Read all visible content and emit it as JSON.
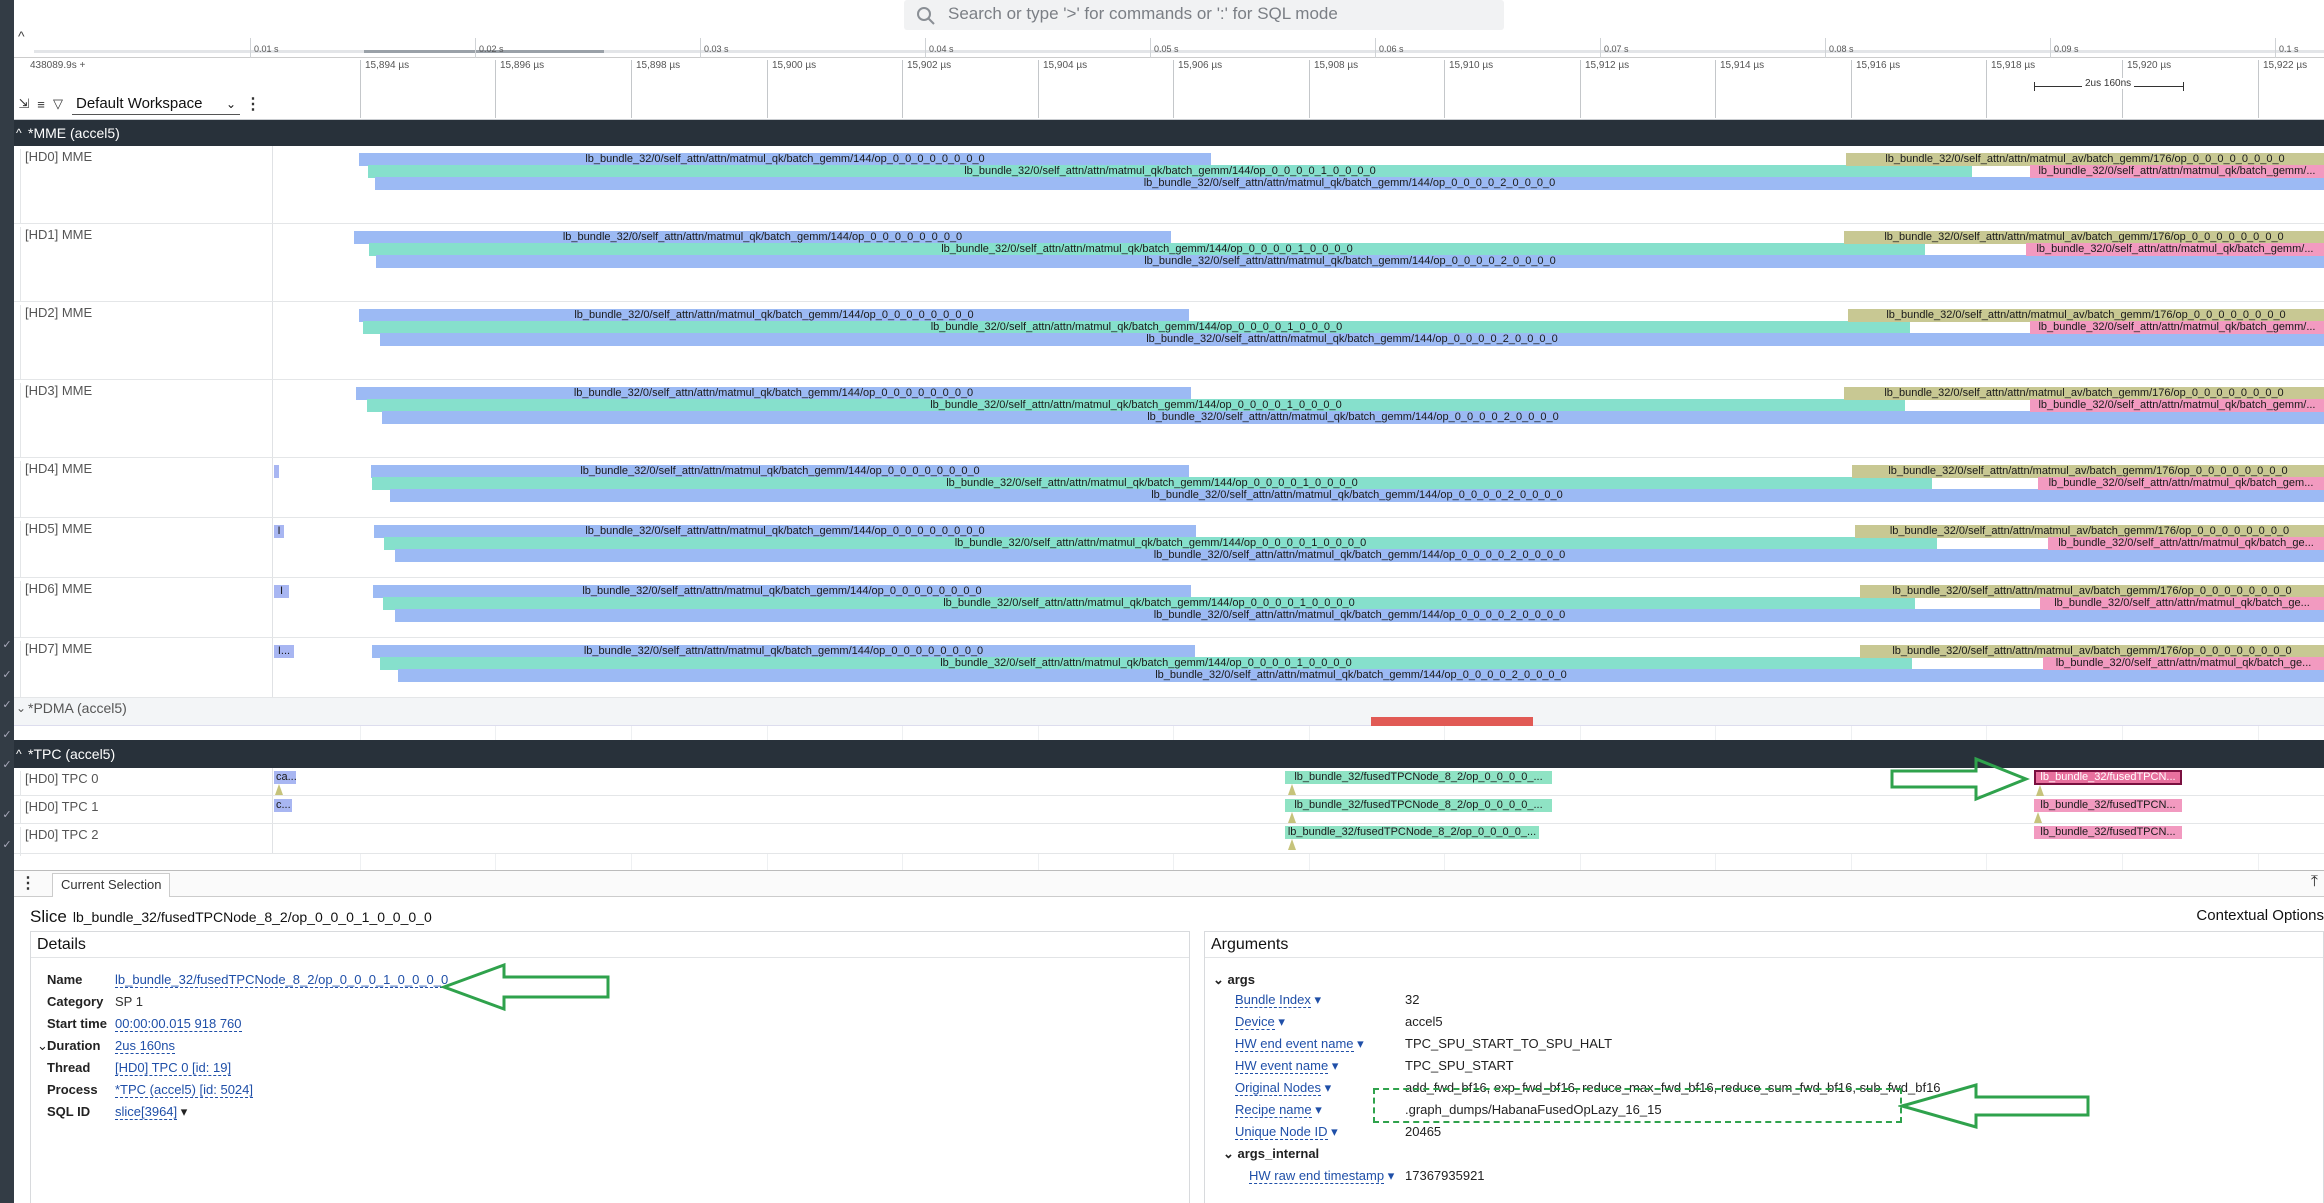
{
  "search": {
    "placeholder": "Search or type '>' for commands or ':' for SQL mode"
  },
  "overview": {
    "ticks": [
      "0.01 s",
      "0.02 s",
      "0.03 s",
      "0.04 s",
      "0.05 s",
      "0.06 s",
      "0.07 s",
      "0.08 s",
      "0.09 s",
      "0.1 s"
    ]
  },
  "ruler": {
    "offset": "438089.9s +",
    "ticks": [
      "15,894 µs",
      "15,896 µs",
      "15,898 µs",
      "15,900 µs",
      "15,902 µs",
      "15,904 µs",
      "15,906 µs",
      "15,908 µs",
      "15,910 µs",
      "15,912 µs",
      "15,914 µs",
      "15,916 µs",
      "15,918 µs",
      "15,920 µs",
      "15,922 µs"
    ],
    "scale": "2us 160ns"
  },
  "workspace": {
    "name": "Default Workspace"
  },
  "groups": {
    "mme": "*MME (accel5)",
    "pdma": "*PDMA (accel5)",
    "tpc": "*TPC (accel5)"
  },
  "mme_tracks": [
    {
      "label": "[HD0] MME",
      "s1": "lb_bundle_32/0/self_attn/attn/matmul_qk/batch_gemm/144/op_0_0_0_0_0_0_0_0",
      "s2": "lb_bundle_32/0/self_attn/attn/matmul_qk/batch_gemm/144/op_0_0_0_0_1_0_0_0_0",
      "s3": "lb_bundle_32/0/self_attn/attn/matmul_qk/batch_gemm/144/op_0_0_0_0_2_0_0_0_0",
      "av": "lb_bundle_32/0/self_attn/attn/matmul_av/batch_gemm/176/op_0_0_0_0_0_0_0_0",
      "pk": "lb_bundle_32/0/self_attn/attn/matmul_qk/batch_gemm/..."
    },
    {
      "label": "[HD1] MME",
      "s1": "lb_bundle_32/0/self_attn/attn/matmul_qk/batch_gemm/144/op_0_0_0_0_0_0_0_0",
      "s2": "lb_bundle_32/0/self_attn/attn/matmul_qk/batch_gemm/144/op_0_0_0_0_1_0_0_0_0",
      "s3": "lb_bundle_32/0/self_attn/attn/matmul_qk/batch_gemm/144/op_0_0_0_0_2_0_0_0_0",
      "av": "lb_bundle_32/0/self_attn/attn/matmul_av/batch_gemm/176/op_0_0_0_0_0_0_0_0",
      "pk": "lb_bundle_32/0/self_attn/attn/matmul_qk/batch_gemm/..."
    },
    {
      "label": "[HD2] MME",
      "s1": "lb_bundle_32/0/self_attn/attn/matmul_qk/batch_gemm/144/op_0_0_0_0_0_0_0_0",
      "s2": "lb_bundle_32/0/self_attn/attn/matmul_qk/batch_gemm/144/op_0_0_0_0_1_0_0_0_0",
      "s3": "lb_bundle_32/0/self_attn/attn/matmul_qk/batch_gemm/144/op_0_0_0_0_2_0_0_0_0",
      "av": "lb_bundle_32/0/self_attn/attn/matmul_av/batch_gemm/176/op_0_0_0_0_0_0_0_0",
      "pk": "lb_bundle_32/0/self_attn/attn/matmul_qk/batch_gemm/..."
    },
    {
      "label": "[HD3] MME",
      "s1": "lb_bundle_32/0/self_attn/attn/matmul_qk/batch_gemm/144/op_0_0_0_0_0_0_0_0",
      "s2": "lb_bundle_32/0/self_attn/attn/matmul_qk/batch_gemm/144/op_0_0_0_0_1_0_0_0_0",
      "s3": "lb_bundle_32/0/self_attn/attn/matmul_qk/batch_gemm/144/op_0_0_0_0_2_0_0_0_0",
      "av": "lb_bundle_32/0/self_attn/attn/matmul_av/batch_gemm/176/op_0_0_0_0_0_0_0_0",
      "pk": "lb_bundle_32/0/self_attn/attn/matmul_qk/batch_gemm/..."
    },
    {
      "label": "[HD4] MME",
      "s1": "lb_bundle_32/0/self_attn/attn/matmul_qk/batch_gemm/144/op_0_0_0_0_0_0_0_0",
      "s2": "lb_bundle_32/0/self_attn/attn/matmul_qk/batch_gemm/144/op_0_0_0_0_1_0_0_0_0",
      "s3": "lb_bundle_32/0/self_attn/attn/matmul_qk/batch_gemm/144/op_0_0_0_0_2_0_0_0_0",
      "av": "lb_bundle_32/0/self_attn/attn/matmul_av/batch_gemm/176/op_0_0_0_0_0_0_0_0",
      "pk": "lb_bundle_32/0/self_attn/attn/matmul_qk/batch_gem..."
    },
    {
      "label": "[HD5] MME",
      "s1": "lb_bundle_32/0/self_attn/attn/matmul_qk/batch_gemm/144/op_0_0_0_0_0_0_0_0",
      "s2": "lb_bundle_32/0/self_attn/attn/matmul_qk/batch_gemm/144/op_0_0_0_0_1_0_0_0_0",
      "s3": "lb_bundle_32/0/self_attn/attn/matmul_qk/batch_gemm/144/op_0_0_0_0_2_0_0_0_0",
      "av": "lb_bundle_32/0/self_attn/attn/matmul_av/batch_gemm/176/op_0_0_0_0_0_0_0_0",
      "pk": "lb_bundle_32/0/self_attn/attn/matmul_qk/batch_ge..."
    },
    {
      "label": "[HD6] MME",
      "s1": "lb_bundle_32/0/self_attn/attn/matmul_qk/batch_gemm/144/op_0_0_0_0_0_0_0_0",
      "s2": "lb_bundle_32/0/self_attn/attn/matmul_qk/batch_gemm/144/op_0_0_0_0_1_0_0_0_0",
      "s3": "lb_bundle_32/0/self_attn/attn/matmul_qk/batch_gemm/144/op_0_0_0_0_2_0_0_0_0",
      "av": "lb_bundle_32/0/self_attn/attn/matmul_av/batch_gemm/176/op_0_0_0_0_0_0_0_0",
      "pk": "lb_bundle_32/0/self_attn/attn/matmul_qk/batch_ge..."
    },
    {
      "label": "[HD7] MME",
      "s1": "lb_bundle_32/0/self_attn/attn/matmul_qk/batch_gemm/144/op_0_0_0_0_0_0_0_0",
      "s2": "lb_bundle_32/0/self_attn/attn/matmul_qk/batch_gemm/144/op_0_0_0_0_1_0_0_0_0",
      "s3": "lb_bundle_32/0/self_attn/attn/matmul_qk/batch_gemm/144/op_0_0_0_0_2_0_0_0_0",
      "av": "lb_bundle_32/0/self_attn/attn/matmul_av/batch_gemm/176/op_0_0_0_0_0_0_0_0",
      "pk": "lb_bundle_32/0/self_attn/attn/matmul_qk/batch_ge..."
    }
  ],
  "mme_small": [
    "",
    "I",
    "I",
    "I..."
  ],
  "tpc_tracks": [
    {
      "label": "[HD0] TPC 0",
      "small": "ca...",
      "mid": "lb_bundle_32/fusedTPCNode_8_2/op_0_0_0_0_...",
      "right": "lb_bundle_32/fusedTPCN..."
    },
    {
      "label": "[HD0] TPC 1",
      "small": "c...",
      "mid": "lb_bundle_32/fusedTPCNode_8_2/op_0_0_0_0_...",
      "right": "lb_bundle_32/fusedTPCN..."
    },
    {
      "label": "[HD0] TPC 2",
      "small": "",
      "mid": "lb_bundle_32/fusedTPCNode_8_2/op_0_0_0_0_...",
      "right": "lb_bundle_32/fusedTPCN..."
    }
  ],
  "bottom": {
    "tab": "Current Selection",
    "slice_kw": "Slice",
    "slice_name": "lb_bundle_32/fusedTPCNode_8_2/op_0_0_0_1_0_0_0_0",
    "contextual": "Contextual Options",
    "details_title": "Details",
    "details": [
      {
        "k": "Name",
        "v": "lb_bundle_32/fusedTPCNode_8_2/op_0_0_0_1_0_0_0_0"
      },
      {
        "k": "Category",
        "v": "SP 1"
      },
      {
        "k": "Start time",
        "v": "00:00:00.015 918 760"
      },
      {
        "k": "Duration",
        "v": "2us 160ns"
      },
      {
        "k": "Thread",
        "v": "[HD0] TPC 0 [id: 19]"
      },
      {
        "k": "Process",
        "v": "*TPC (accel5) [id: 5024]"
      },
      {
        "k": "SQL ID",
        "v": "slice[3964]"
      }
    ],
    "args_title": "Arguments",
    "args_section": "args",
    "args": [
      {
        "k": "Bundle Index",
        "v": "32"
      },
      {
        "k": "Device",
        "v": "accel5"
      },
      {
        "k": "HW end event name",
        "v": "TPC_SPU_START_TO_SPU_HALT"
      },
      {
        "k": "HW event name",
        "v": "TPC_SPU_START"
      },
      {
        "k": "Original Nodes",
        "v": "add_fwd_bf16, exp_fwd_bf16, reduce_max_fwd_bf16, reduce_sum_fwd_bf16, sub_fwd_bf16"
      },
      {
        "k": "Recipe name",
        "v": ".graph_dumps/HabanaFusedOpLazy_16_15"
      },
      {
        "k": "Unique Node ID",
        "v": "20465"
      }
    ],
    "args_internal": "args_internal",
    "internal": [
      {
        "k": "HW raw end timestamp",
        "v": "17367935921"
      }
    ]
  },
  "colors": {
    "mme_qk": "#9cbaf4",
    "mme_qk2": "#86e0cc",
    "mme_av": "#c8c893",
    "mme_pink": "#f29ac0",
    "tpc": "#8fe3c4",
    "pdma": "#e15a55",
    "annotation": "#2fa24c"
  }
}
